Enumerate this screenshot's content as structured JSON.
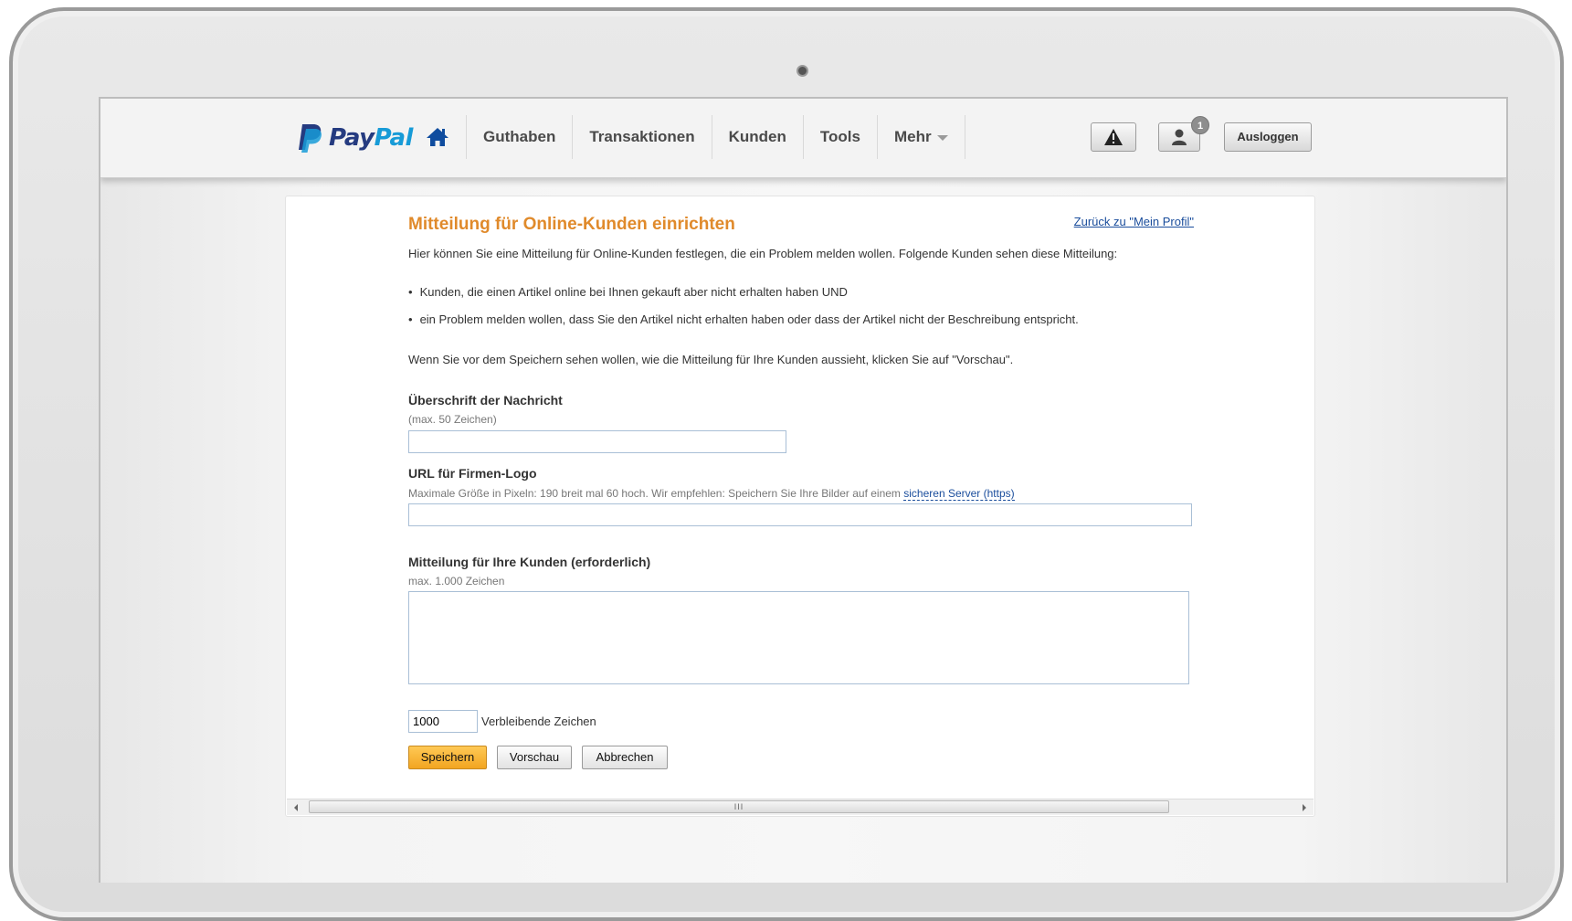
{
  "header": {
    "logo_pay": "Pay",
    "logo_pal": "Pal",
    "nav": [
      "Guthaben",
      "Transaktionen",
      "Kunden",
      "Tools",
      "Mehr"
    ],
    "notification_count": "1",
    "logout_label": "Ausloggen",
    "icons": [
      "paypal-logo",
      "home-icon",
      "alert-icon",
      "user-icon"
    ]
  },
  "form": {
    "title": "Mitteilung für Online-Kunden einrichten",
    "back_link": "Zurück zu \"Mein Profil\"",
    "intro": "Hier können Sie eine Mitteilung für Online-Kunden festlegen, die ein Problem melden wollen. Folgende Kunden sehen diese Mitteilung:",
    "bullets": [
      "Kunden, die einen Artikel online bei Ihnen gekauft aber nicht erhalten haben UND",
      "ein Problem melden wollen, dass Sie den Artikel nicht erhalten haben oder dass der Artikel nicht der Beschreibung entspricht."
    ],
    "preview_note": "Wenn Sie vor dem Speichern sehen wollen, wie die Mitteilung für Ihre Kunden aussieht, klicken Sie auf \"Vorschau\".",
    "heading_label": "Überschrift der Nachricht",
    "heading_hint": "(max. 50 Zeichen)",
    "heading_value": "",
    "logo_label": "URL für Firmen-Logo",
    "logo_hint": "Maximale Größe in Pixeln: 190 breit mal 60 hoch. Wir empfehlen: Speichern Sie Ihre Bilder auf einem",
    "logo_hint_link": "sicheren Server (https)",
    "logo_value": "",
    "message_label": "Mitteilung für Ihre Kunden (erforderlich)",
    "message_hint": "max. 1.000 Zeichen",
    "message_value": "",
    "remaining_value": "1000",
    "remaining_label": "Verbleibende Zeichen",
    "save_label": "Speichern",
    "preview_label": "Vorschau",
    "cancel_label": "Abbrechen"
  },
  "scrollbar": {
    "grip": "III"
  },
  "colors": {
    "title": "#e08a2b",
    "link": "#1a4d9c",
    "primary_button": "#f2a521",
    "paypal_dark": "#253b80",
    "paypal_light": "#179bd7"
  }
}
